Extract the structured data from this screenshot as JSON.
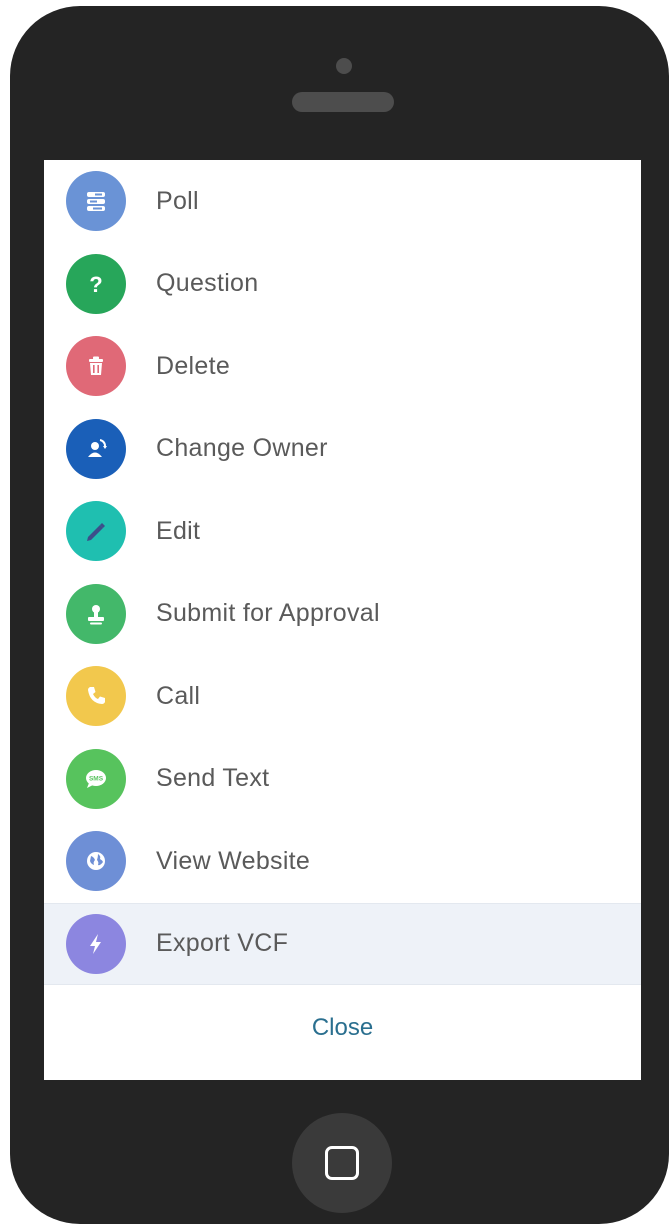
{
  "actions": [
    {
      "label": "Poll",
      "icon": "poll-icon",
      "color": "#6a93d6"
    },
    {
      "label": "Question",
      "icon": "question-icon",
      "color": "#27a65a"
    },
    {
      "label": "Delete",
      "icon": "trash-icon",
      "color": "#e06977"
    },
    {
      "label": "Change Owner",
      "icon": "change-owner-icon",
      "color": "#1a5fb8"
    },
    {
      "label": "Edit",
      "icon": "pencil-icon",
      "color": "#1fbfb0"
    },
    {
      "label": "Submit for Approval",
      "icon": "approval-stamp-icon",
      "color": "#43b86a"
    },
    {
      "label": "Call",
      "icon": "phone-icon",
      "color": "#f2c84d"
    },
    {
      "label": "Send Text",
      "icon": "sms-icon",
      "color": "#57c35d"
    },
    {
      "label": "View Website",
      "icon": "globe-icon",
      "color": "#6e8fd6"
    },
    {
      "label": "Export VCF",
      "icon": "lightning-icon",
      "color": "#8c86e0"
    }
  ],
  "selected_action": "Export VCF",
  "close_label": "Close"
}
